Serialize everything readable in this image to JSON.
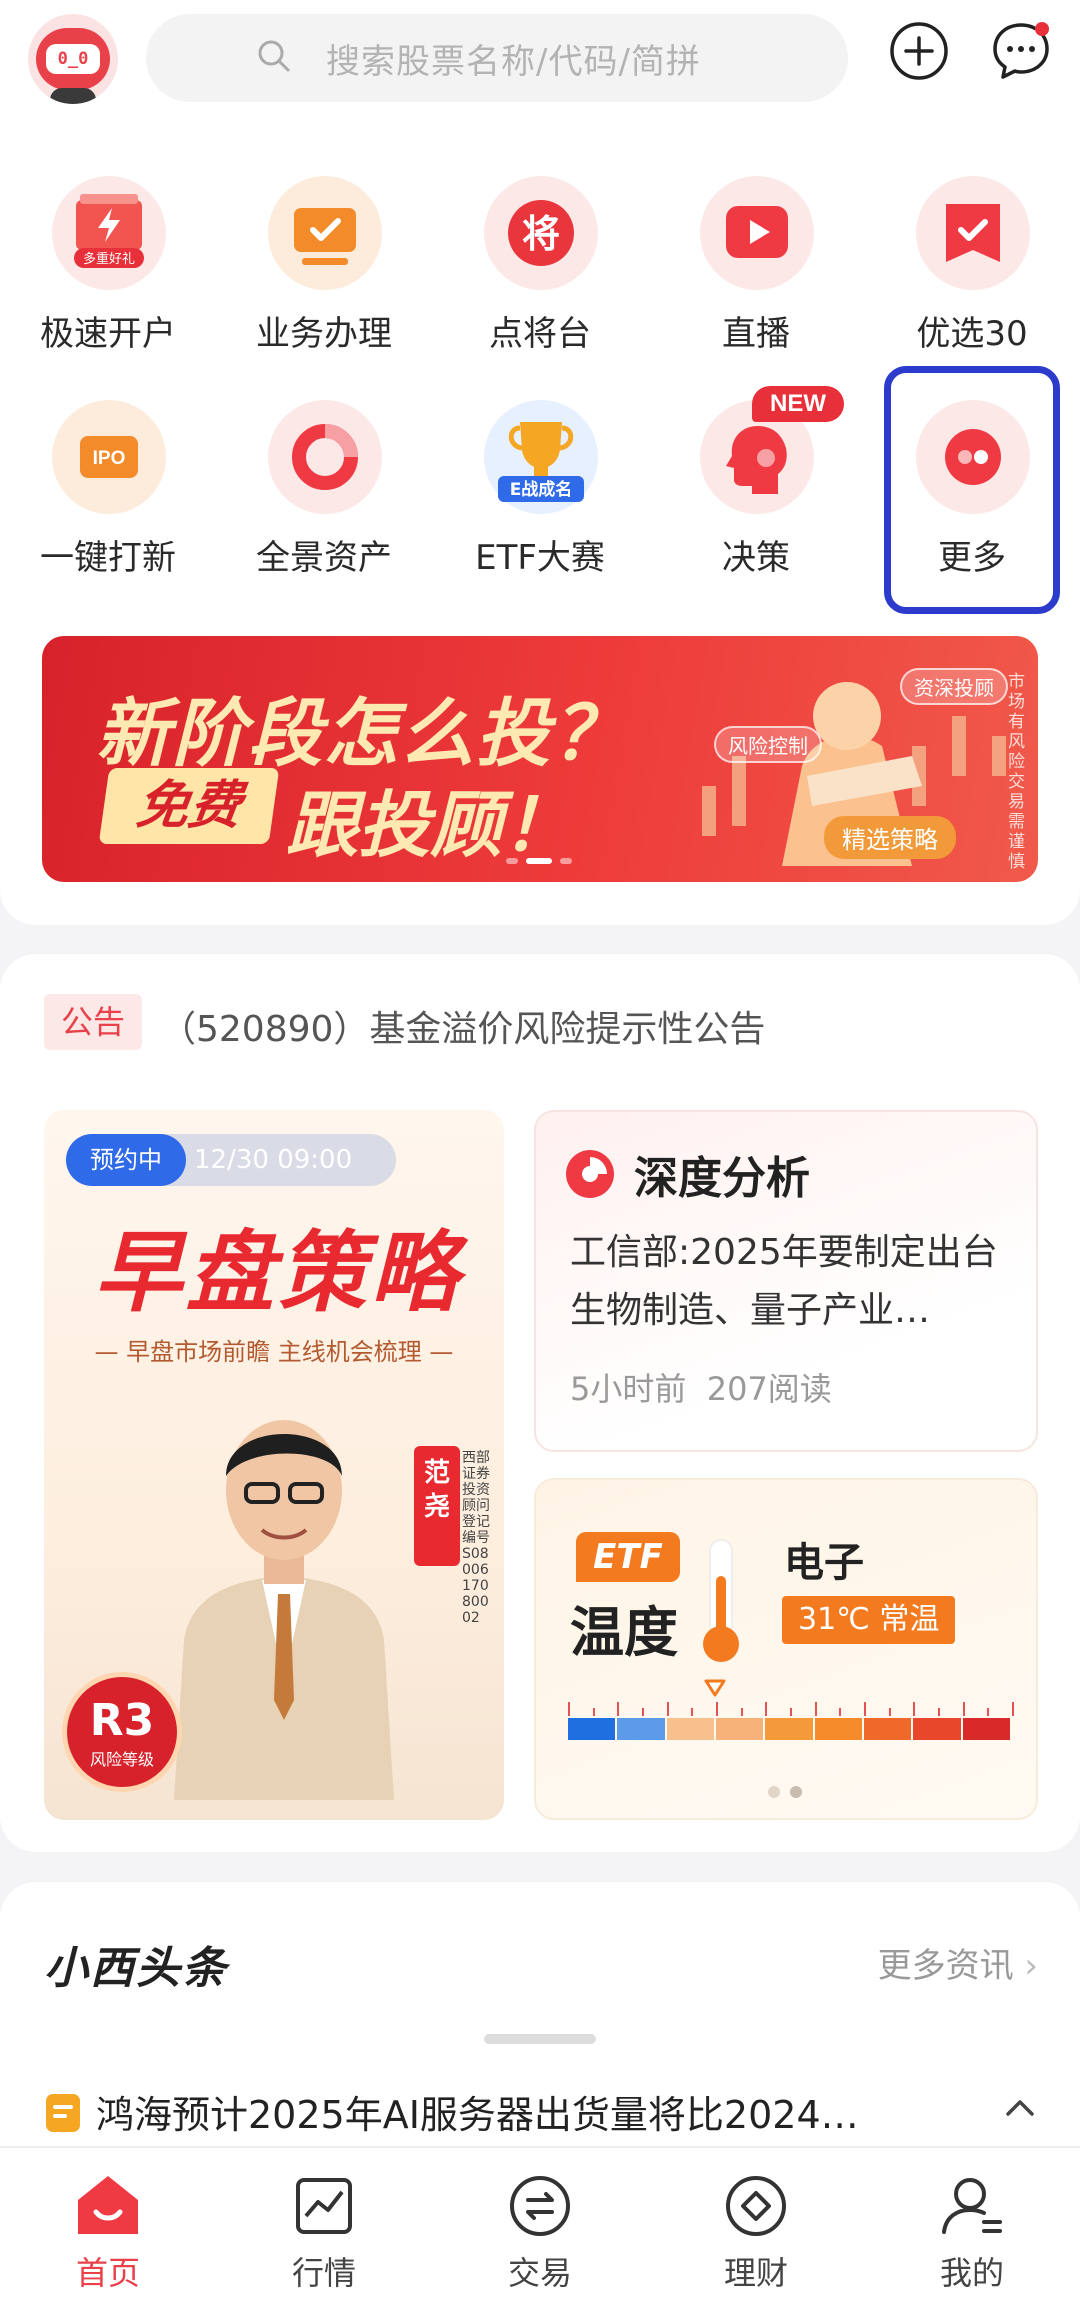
{
  "header": {
    "search_placeholder": "搜索股票名称/代码/简拼",
    "avatar_face": "0_0",
    "icons": [
      "robot-avatar-icon",
      "search-icon",
      "add-icon",
      "message-icon"
    ]
  },
  "shortcuts": [
    {
      "label": "极速开户",
      "icon": "account-gift-icon",
      "badge": "多重好礼"
    },
    {
      "label": "业务办理",
      "icon": "business-screen-icon"
    },
    {
      "label": "点将台",
      "icon": "general-seal-icon",
      "glyph": "将"
    },
    {
      "label": "直播",
      "icon": "live-video-icon"
    },
    {
      "label": "优选30",
      "icon": "bookmark-check-icon"
    },
    {
      "label": "一键打新",
      "icon": "ipo-icon",
      "glyph": "IPO"
    },
    {
      "label": "全景资产",
      "icon": "donut-chart-icon"
    },
    {
      "label": "ETF大赛",
      "icon": "trophy-icon",
      "glyph": "E战成名"
    },
    {
      "label": "决策",
      "icon": "decision-head-icon",
      "badge": "NEW"
    },
    {
      "label": "更多",
      "icon": "more-dots-icon"
    }
  ],
  "banner": {
    "line1": "新阶段怎么投？",
    "free": "免费",
    "line2": "跟投顾！",
    "tags": [
      "资深投顾",
      "风险控制",
      "精选策略"
    ],
    "disclaimer": "市场有风险交易需谨慎"
  },
  "notice": {
    "tag": "公告",
    "text": "（520890）基金溢价风险提示性公告"
  },
  "live_card": {
    "status": "预约中",
    "time": "12/30 09:00",
    "title": "早盘策略",
    "subtitle": "— 早盘市场前瞻 主线机会梳理 —",
    "host": "范尧",
    "registration": "西部证券投资顾问登记编号S0800617080002",
    "risk_level": "R3",
    "risk_label": "风险等级"
  },
  "analysis_card": {
    "title": "深度分析",
    "body": "工信部:2025年要制定出台生物制造、量子产业…",
    "time": "5小时前",
    "reads": "207阅读"
  },
  "etf_card": {
    "tag": "ETF",
    "title": "温度",
    "sector": "电子",
    "temperature": "31℃ 常温",
    "scale_level": 0.33,
    "scale_colors": [
      "#1f6fe0",
      "#5b9bea",
      "#f7c08c",
      "#f7b27a",
      "#f59a3a",
      "#f48a2a",
      "#ef6a2a",
      "#e8472c",
      "#d92a2a"
    ]
  },
  "news": {
    "brand": "小西头条",
    "more": "更多资讯",
    "headline": "鸿海预计2025年AI服务器出货量将比2024…"
  },
  "bottom_nav": [
    {
      "label": "首页",
      "icon": "home-icon",
      "active": true
    },
    {
      "label": "行情",
      "icon": "market-chart-icon",
      "active": false
    },
    {
      "label": "交易",
      "icon": "trade-exchange-icon",
      "active": false
    },
    {
      "label": "理财",
      "icon": "wealth-diamond-icon",
      "active": false
    },
    {
      "label": "我的",
      "icon": "profile-icon",
      "active": false
    }
  ],
  "colors": {
    "brand_red": "#e8414a",
    "highlight_blue": "#2c3bcc",
    "etf_orange": "#f37a1f"
  }
}
